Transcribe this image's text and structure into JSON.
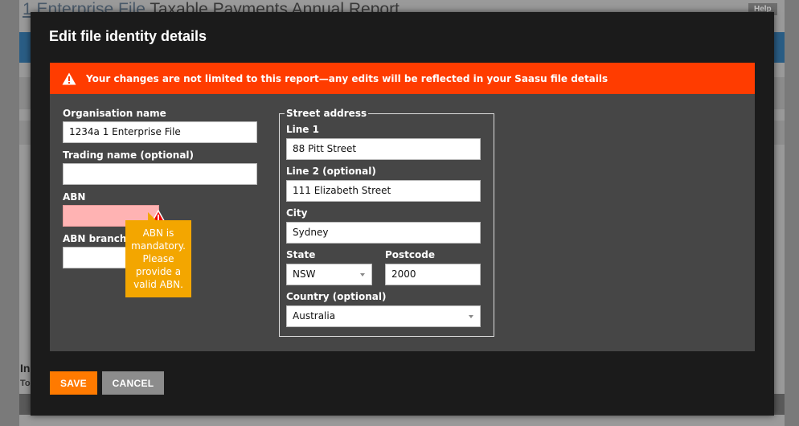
{
  "background": {
    "file_link": "1 Enterprise File",
    "title_separator": " ",
    "report_title": "Taxable Payments Annual Report",
    "help_label": "Help",
    "left_label_1": "In",
    "left_label_2": "To"
  },
  "modal": {
    "title": "Edit file identity details",
    "warning": "Your changes are not limited to this report—any edits will be reflected in your Saasu file details",
    "left": {
      "org_name_label": "Organisation name",
      "org_name_value": "1234a 1 Enterprise File",
      "trading_name_label": "Trading name (optional)",
      "trading_name_value": "",
      "abn_label": "ABN",
      "abn_value": "",
      "abn_branch_label": "ABN branch (o",
      "abn_branch_value": "",
      "abn_error_tooltip": "ABN is mandatory. Please provide a valid ABN."
    },
    "address": {
      "legend": "Street address",
      "line1_label": "Line 1",
      "line1_value": "88 Pitt Street",
      "line2_label": "Line 2 (optional)",
      "line2_value": "111 Elizabeth Street",
      "city_label": "City",
      "city_value": "Sydney",
      "state_label": "State",
      "state_value": "NSW",
      "postcode_label": "Postcode",
      "postcode_value": "2000",
      "country_label": "Country (optional)",
      "country_value": "Australia"
    },
    "buttons": {
      "save": "SAVE",
      "cancel": "CANCEL"
    },
    "colors": {
      "warning_bg": "#ff3c00",
      "save_bg": "#ff7a00",
      "tooltip_bg": "#f3a600",
      "error_field_bg": "#ffb3b3"
    }
  }
}
